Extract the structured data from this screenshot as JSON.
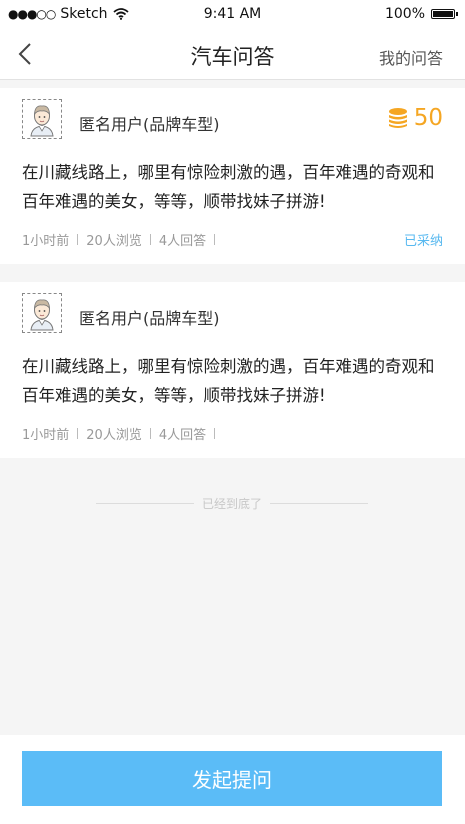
{
  "status_bar": {
    "carrier": "Sketch",
    "time": "9:41 AM",
    "battery": "100%"
  },
  "nav": {
    "title": "汽车问答",
    "right_link": "我的问答"
  },
  "questions": [
    {
      "user": "匿名用户(品牌车型)",
      "reward": "50",
      "text": "在川藏线路上，哪里有惊险刺激的遇，百年难遇的奇观和百年难遇的美女，等等，顺带找妹子拼游!",
      "time": "1小时前",
      "views": "20人浏览",
      "answers": "4人回答",
      "status": "已采纳"
    },
    {
      "user": "匿名用户(品牌车型)",
      "text": "在川藏线路上，哪里有惊险刺激的遇，百年难遇的奇观和百年难遇的美女，等等，顺带找妹子拼游!",
      "time": "1小时前",
      "views": "20人浏览",
      "answers": "4人回答"
    }
  ],
  "end_text": "已经到底了",
  "ask_button": "发起提问",
  "colors": {
    "accent": "#5bbcf7",
    "reward": "#f5a623",
    "adopted": "#58b9f0"
  }
}
